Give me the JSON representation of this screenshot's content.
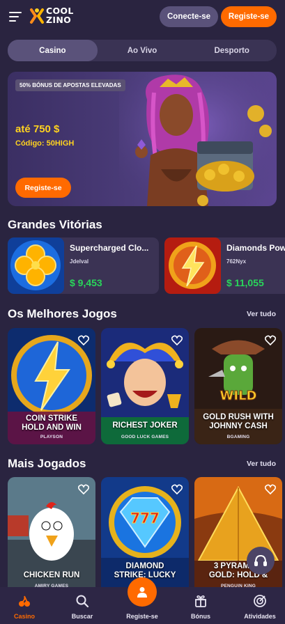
{
  "header": {
    "logo_line1": "COOL",
    "logo_line2": "ZINO",
    "login_label": "Conecte-se",
    "register_label": "Registe-se"
  },
  "tabs": [
    {
      "label": "Casino",
      "active": true
    },
    {
      "label": "Ao Vivo",
      "active": false
    },
    {
      "label": "Desporto",
      "active": false
    }
  ],
  "banner": {
    "tag": "50% BÓNUS DE APOSTAS ELEVADAS",
    "amount": "até 750 $",
    "code": "Código: 50HIGH",
    "button": "Registe-se"
  },
  "big_wins": {
    "title": "Grandes Vitórias",
    "items": [
      {
        "game": "Supercharged Clo...",
        "user": "Jdelval",
        "amount": "$ 9,453"
      },
      {
        "game": "Diamonds Pow",
        "user": "762Nyx",
        "amount": "$ 11,055"
      }
    ]
  },
  "best_games": {
    "title": "Os Melhores Jogos",
    "see_all": "Ver tudo",
    "items": [
      {
        "name_line1": "COIN STRIKE",
        "name_line2": "HOLD AND WIN",
        "provider": "PLAYSON"
      },
      {
        "name_line1": "RICHEST JOKER",
        "name_line2": "",
        "provider": "GOOD LUCK GAMES"
      },
      {
        "name_line1": "GOLD RUSH WITH",
        "name_line2": "JOHNNY CASH",
        "provider": "BGAMING"
      }
    ]
  },
  "most_played": {
    "title": "Mais Jogados",
    "see_all": "Ver tudo",
    "items": [
      {
        "name_line1": "CHICKEN RUN",
        "name_line2": "",
        "provider": "AMIRY GAMES"
      },
      {
        "name_line1": "DIAMOND",
        "name_line2": "STRIKE: LUCKY",
        "provider": ""
      },
      {
        "name_line1": "3 PYRAMIDS",
        "name_line2": "GOLD: HOLD &",
        "provider": "PENGUIN KING"
      }
    ]
  },
  "bottom_nav": [
    {
      "label": "Casino",
      "icon": "cherries-icon",
      "active": true
    },
    {
      "label": "Buscar",
      "icon": "search-icon",
      "active": false
    },
    {
      "label": "Registe-se",
      "icon": "user-icon",
      "active": false
    },
    {
      "label": "Bónus",
      "icon": "gift-icon",
      "active": false
    },
    {
      "label": "Atividades",
      "icon": "target-icon",
      "active": false
    }
  ],
  "colors": {
    "background": "#2a2440",
    "accent": "#ff6a00",
    "win_green": "#29d65a",
    "banner_yellow": "#ffd21f"
  }
}
